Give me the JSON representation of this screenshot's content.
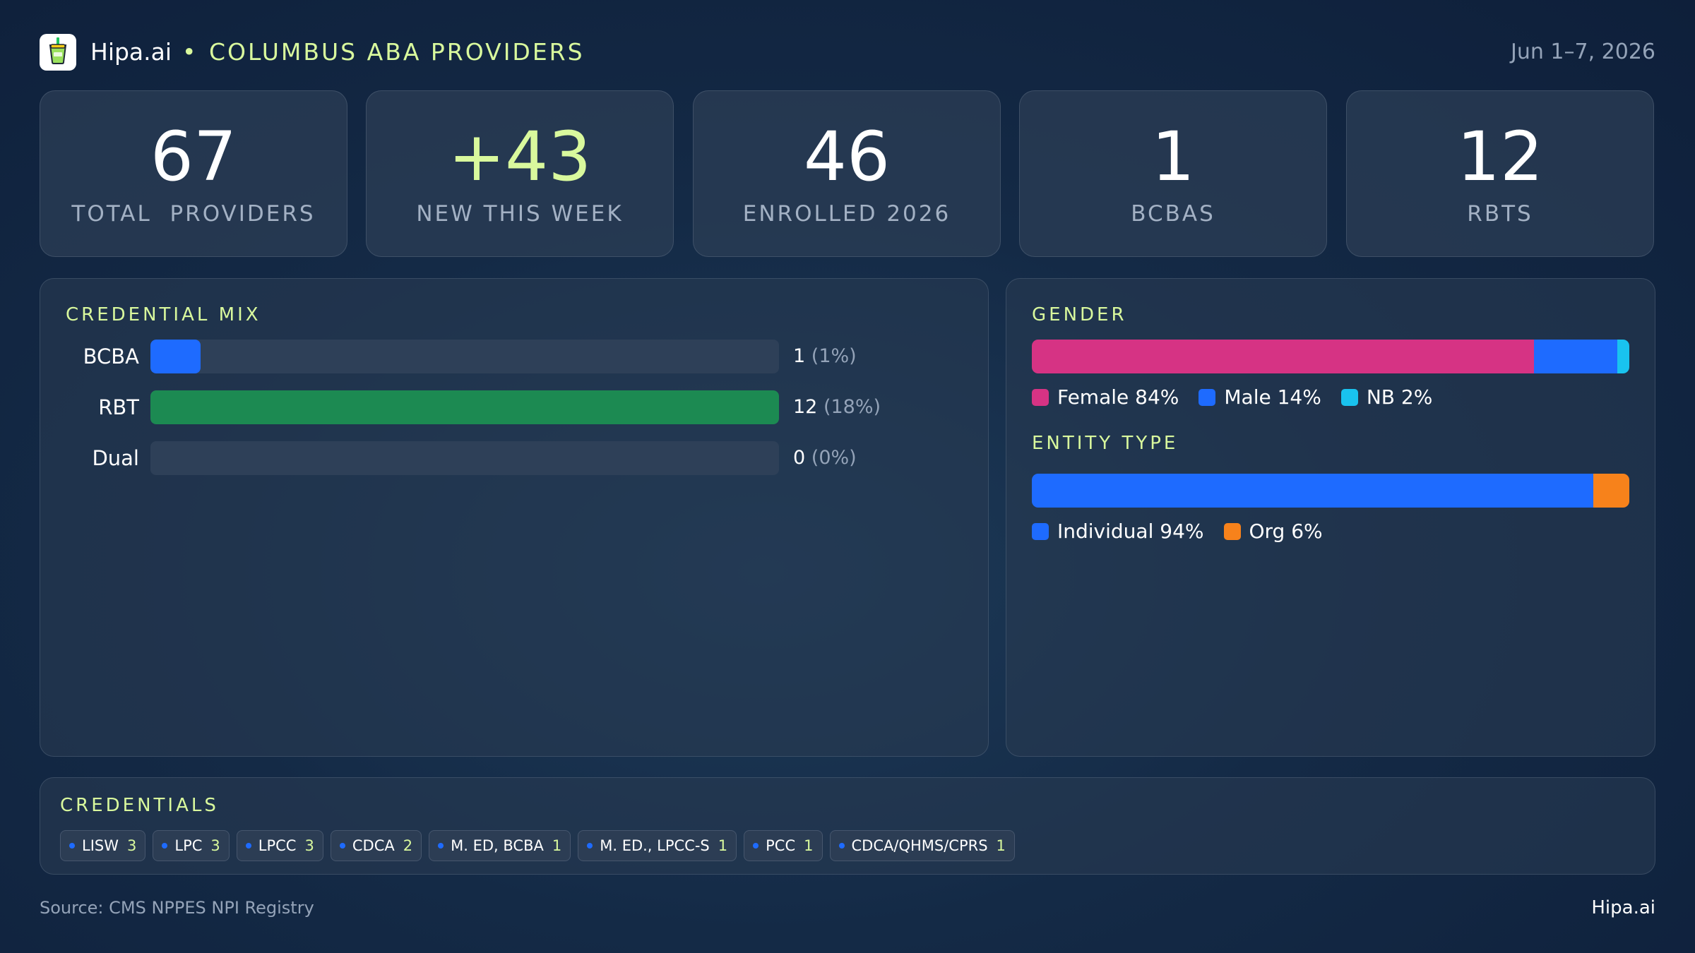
{
  "header": {
    "brand": "Hipa.ai",
    "separator": "•",
    "title": "COLUMBUS ABA PROVIDERS",
    "date_range": "Jun 1–7, 2026",
    "logo_icon": "drink-cup-icon"
  },
  "stats": [
    {
      "value": "67",
      "label": "TOTAL  PROVIDERS"
    },
    {
      "value": "+43",
      "label": "NEW THIS WEEK"
    },
    {
      "value": "46",
      "label": "ENROLLED 2026"
    },
    {
      "value": "1",
      "label": "BCBAS"
    },
    {
      "value": "12",
      "label": "RBTS"
    }
  ],
  "credential_mix": {
    "title": "CREDENTIAL MIX",
    "rows": [
      {
        "label": "BCBA",
        "count": "1",
        "pct_text": "(1%)",
        "fraction": 0.08,
        "color": "#1e6bff"
      },
      {
        "label": "RBT",
        "count": "12",
        "pct_text": "(18%)",
        "fraction": 1.0,
        "color": "#1c8a52"
      },
      {
        "label": "Dual",
        "count": "0",
        "pct_text": "(0%)",
        "fraction": 0.0,
        "color": "#2e4058"
      }
    ]
  },
  "gender": {
    "title": "GENDER",
    "segments": [
      {
        "label": "Female 84%",
        "value": 84,
        "color": "#d63384"
      },
      {
        "label": "Male 14%",
        "value": 14,
        "color": "#1e6bff"
      },
      {
        "label": "NB 2%",
        "value": 2,
        "color": "#19c3ef"
      }
    ]
  },
  "entity_type": {
    "title": "ENTITY TYPE",
    "segments": [
      {
        "label": "Individual 94%",
        "value": 94,
        "color": "#1e6bff"
      },
      {
        "label": "Org 6%",
        "value": 6,
        "color": "#f7821b"
      }
    ]
  },
  "credentials": {
    "title": "CREDENTIALS",
    "chips": [
      {
        "label": "LISW",
        "count": "3"
      },
      {
        "label": "LPC",
        "count": "3"
      },
      {
        "label": "LPCC",
        "count": "3"
      },
      {
        "label": "CDCA",
        "count": "2"
      },
      {
        "label": "M. ED, BCBA",
        "count": "1"
      },
      {
        "label": "M. ED., LPCC-S",
        "count": "1"
      },
      {
        "label": "PCC",
        "count": "1"
      },
      {
        "label": "CDCA/QHMS/CPRS",
        "count": "1"
      }
    ]
  },
  "footer": {
    "source": "Source: CMS NPPES NPI Registry",
    "brand": "Hipa.ai"
  }
}
